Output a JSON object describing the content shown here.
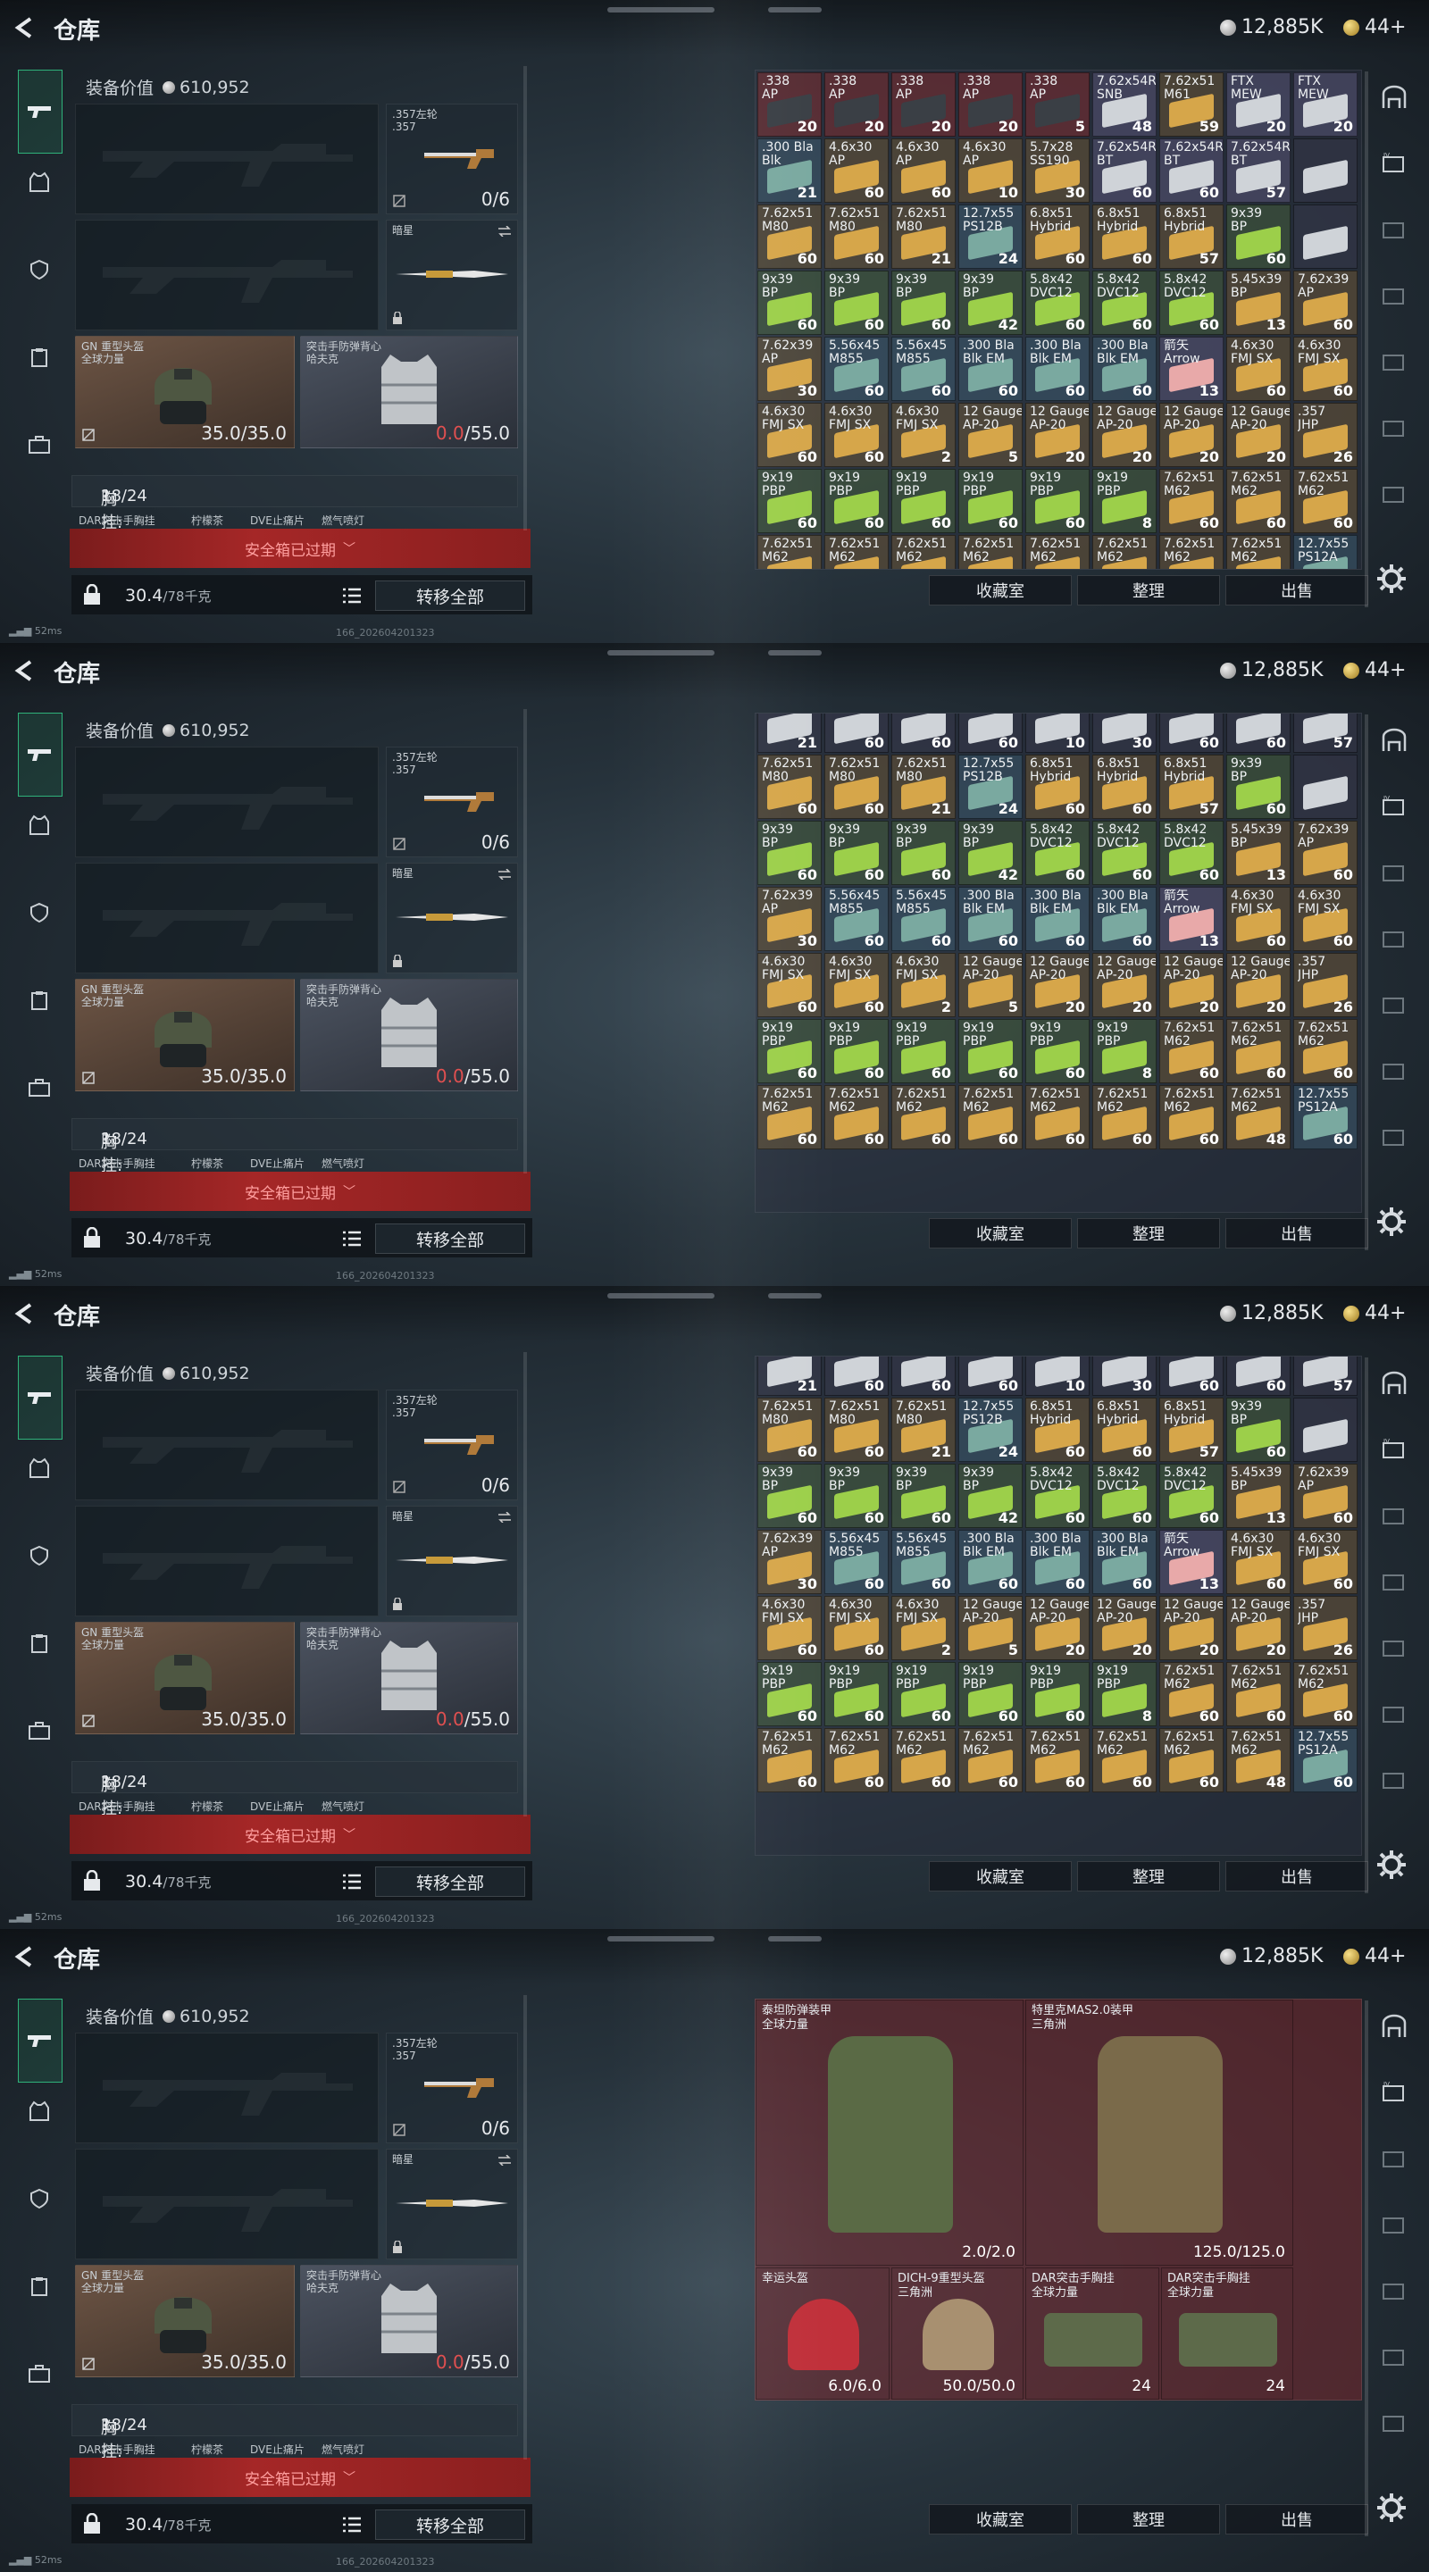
{
  "header": {
    "title": "仓库",
    "silver": "12,885K",
    "gold": "44+"
  },
  "left": {
    "equip_label": "装备价值",
    "equip_value": "610,952",
    "secondary_weapon": {
      "name_line1": ".357左轮",
      "name_line2": ".357",
      "count": "0/6"
    },
    "melee": {
      "name": "暗星"
    },
    "helmet": {
      "name": "GN 重型头盔",
      "brand": "全球力量",
      "durability_cur": "35.0",
      "durability_max": "/35.0"
    },
    "vest": {
      "name": "突击手防弹背心",
      "brand": "哈夫克",
      "durability_cur": "0.0",
      "durability_max": "/55.0"
    },
    "rig": "胸挂:",
    "rig_count": "18/24",
    "rig_help": "?",
    "strip_items": [
      "DAR突击手胸挂",
      "柠檬茶",
      "DVE止痛片",
      "燃气喷灯"
    ],
    "expire": "安全箱已过期",
    "weight": "30.4",
    "weight_max": "/78千克",
    "transfer": "转移全部"
  },
  "buttons": {
    "collect": "收藏室",
    "sort": "整理",
    "sell": "出售"
  },
  "status": {
    "ping": "52ms",
    "build": "166_202604201323"
  },
  "grids": [
    {
      "rows": [
        [
          [
            ".338\nAP",
            "20"
          ],
          [
            ".338\nAP",
            "20"
          ],
          [
            ".338\nAP",
            "20"
          ],
          [
            ".338\nAP",
            "20"
          ],
          [
            ".338\nAP",
            "5"
          ],
          [
            "7.62x54R\nSNB",
            "48"
          ],
          [
            "7.62x51\nM61",
            "59"
          ],
          [
            "FTX\nMEW",
            "20"
          ],
          [
            "FTX\nMEW",
            "20"
          ]
        ],
        [
          [
            ".300 Bla\nBlk",
            "21"
          ],
          [
            "4.6x30\nAP",
            "60"
          ],
          [
            "4.6x30\nAP",
            "60"
          ],
          [
            "4.6x30\nAP",
            "10"
          ],
          [
            "5.7x28\nSS190",
            "30"
          ],
          [
            "7.62x54R\nBT",
            "60"
          ],
          [
            "7.62x54R\nBT",
            "60"
          ],
          [
            "7.62x54R\nBT",
            "57"
          ],
          [
            "",
            ""
          ]
        ],
        [
          [
            "7.62x51\nM80",
            "60"
          ],
          [
            "7.62x51\nM80",
            "60"
          ],
          [
            "7.62x51\nM80",
            "21"
          ],
          [
            "12.7x55\nPS12B",
            "24"
          ],
          [
            "6.8x51\nHybrid",
            "60"
          ],
          [
            "6.8x51\nHybrid",
            "60"
          ],
          [
            "6.8x51\nHybrid",
            "57"
          ],
          [
            "9x39\nBP",
            "60"
          ],
          [
            "",
            ""
          ]
        ],
        [
          [
            "9x39\nBP",
            "60"
          ],
          [
            "9x39\nBP",
            "60"
          ],
          [
            "9x39\nBP",
            "60"
          ],
          [
            "9x39\nBP",
            "42"
          ],
          [
            "5.8x42\nDVC12",
            "60"
          ],
          [
            "5.8x42\nDVC12",
            "60"
          ],
          [
            "5.8x42\nDVC12",
            "60"
          ],
          [
            "5.45x39\nBP",
            "13"
          ],
          [
            "7.62x39\nAP",
            "60"
          ]
        ],
        [
          [
            "7.62x39\nAP",
            "30"
          ],
          [
            "5.56x45\nM855",
            "60"
          ],
          [
            "5.56x45\nM855",
            "60"
          ],
          [
            ".300 Bla\nBlk EM",
            "60"
          ],
          [
            ".300 Bla\nBlk EM",
            "60"
          ],
          [
            ".300 Bla\nBlk EM",
            "60"
          ],
          [
            "箭矢\nArrow",
            "13"
          ],
          [
            "4.6x30\nFMJ SX",
            "60"
          ],
          [
            "4.6x30\nFMJ SX",
            "60"
          ]
        ],
        [
          [
            "4.6x30\nFMJ SX",
            "60"
          ],
          [
            "4.6x30\nFMJ SX",
            "60"
          ],
          [
            "4.6x30\nFMJ SX",
            "2"
          ],
          [
            "12 Gauge\nAP-20",
            "5"
          ],
          [
            "12 Gauge\nAP-20",
            "20"
          ],
          [
            "12 Gauge\nAP-20",
            "20"
          ],
          [
            "12 Gauge\nAP-20",
            "20"
          ],
          [
            "12 Gauge\nAP-20",
            "20"
          ],
          [
            ".357\nJHP",
            "26"
          ]
        ],
        [
          [
            "9x19\nPBP",
            "60"
          ],
          [
            "9x19\nPBP",
            "60"
          ],
          [
            "9x19\nPBP",
            "60"
          ],
          [
            "9x19\nPBP",
            "60"
          ],
          [
            "9x19\nPBP",
            "60"
          ],
          [
            "9x19\nPBP",
            "8"
          ],
          [
            "7.62x51\nM62",
            "60"
          ],
          [
            "7.62x51\nM62",
            "60"
          ],
          [
            "7.62x51\nM62",
            "60"
          ]
        ],
        [
          [
            "7.62x51\nM62",
            "60"
          ],
          [
            "7.62x51\nM62",
            "60"
          ],
          [
            "7.62x51\nM62",
            "60"
          ],
          [
            "7.62x51\nM62",
            "60"
          ],
          [
            "7.62x51\nM62",
            "60"
          ],
          [
            "7.62x51\nM62",
            "60"
          ],
          [
            "7.62x51\nM62",
            "60"
          ],
          [
            "7.62x51\nM62",
            "48"
          ],
          [
            "12.7x55\nPS12A",
            "60"
          ]
        ]
      ]
    },
    {
      "rows": [
        [
          [
            "",
            "21"
          ],
          [
            "",
            "60"
          ],
          [
            "",
            "60"
          ],
          [
            "",
            "60"
          ],
          [
            "",
            "10"
          ],
          [
            "",
            "30"
          ],
          [
            "",
            "60"
          ],
          [
            "",
            "60"
          ],
          [
            "",
            "57"
          ]
        ],
        [
          [
            "7.62x51\nM80",
            "60"
          ],
          [
            "7.62x51\nM80",
            "60"
          ],
          [
            "7.62x51\nM80",
            "21"
          ],
          [
            "12.7x55\nPS12B",
            "24"
          ],
          [
            "6.8x51\nHybrid",
            "60"
          ],
          [
            "6.8x51\nHybrid",
            "60"
          ],
          [
            "6.8x51\nHybrid",
            "57"
          ],
          [
            "9x39\nBP",
            "60"
          ],
          [
            "",
            ""
          ]
        ],
        [
          [
            "9x39\nBP",
            "60"
          ],
          [
            "9x39\nBP",
            "60"
          ],
          [
            "9x39\nBP",
            "60"
          ],
          [
            "9x39\nBP",
            "42"
          ],
          [
            "5.8x42\nDVC12",
            "60"
          ],
          [
            "5.8x42\nDVC12",
            "60"
          ],
          [
            "5.8x42\nDVC12",
            "60"
          ],
          [
            "5.45x39\nBP",
            "13"
          ],
          [
            "7.62x39\nAP",
            "60"
          ]
        ],
        [
          [
            "7.62x39\nAP",
            "30"
          ],
          [
            "5.56x45\nM855",
            "60"
          ],
          [
            "5.56x45\nM855",
            "60"
          ],
          [
            ".300 Bla\nBlk EM",
            "60"
          ],
          [
            ".300 Bla\nBlk EM",
            "60"
          ],
          [
            ".300 Bla\nBlk EM",
            "60"
          ],
          [
            "箭矢\nArrow",
            "13"
          ],
          [
            "4.6x30\nFMJ SX",
            "60"
          ],
          [
            "4.6x30\nFMJ SX",
            "60"
          ]
        ],
        [
          [
            "4.6x30\nFMJ SX",
            "60"
          ],
          [
            "4.6x30\nFMJ SX",
            "60"
          ],
          [
            "4.6x30\nFMJ SX",
            "2"
          ],
          [
            "12 Gauge\nAP-20",
            "5"
          ],
          [
            "12 Gauge\nAP-20",
            "20"
          ],
          [
            "12 Gauge\nAP-20",
            "20"
          ],
          [
            "12 Gauge\nAP-20",
            "20"
          ],
          [
            "12 Gauge\nAP-20",
            "20"
          ],
          [
            ".357\nJHP",
            "26"
          ]
        ],
        [
          [
            "9x19\nPBP",
            "60"
          ],
          [
            "9x19\nPBP",
            "60"
          ],
          [
            "9x19\nPBP",
            "60"
          ],
          [
            "9x19\nPBP",
            "60"
          ],
          [
            "9x19\nPBP",
            "60"
          ],
          [
            "9x19\nPBP",
            "8"
          ],
          [
            "7.62x51\nM62",
            "60"
          ],
          [
            "7.62x51\nM62",
            "60"
          ],
          [
            "7.62x51\nM62",
            "60"
          ]
        ],
        [
          [
            "7.62x51\nM62",
            "60"
          ],
          [
            "7.62x51\nM62",
            "60"
          ],
          [
            "7.62x51\nM62",
            "60"
          ],
          [
            "7.62x51\nM62",
            "60"
          ],
          [
            "7.62x51\nM62",
            "60"
          ],
          [
            "7.62x51\nM62",
            "60"
          ],
          [
            "7.62x51\nM62",
            "60"
          ],
          [
            "7.62x51\nM62",
            "48"
          ],
          [
            "12.7x55\nPS12A",
            "60"
          ]
        ]
      ]
    },
    {
      "rows": [
        [
          [
            "",
            "21"
          ],
          [
            "",
            "60"
          ],
          [
            "",
            "60"
          ],
          [
            "",
            "60"
          ],
          [
            "",
            "10"
          ],
          [
            "",
            "30"
          ],
          [
            "",
            "60"
          ],
          [
            "",
            "60"
          ],
          [
            "",
            "57"
          ]
        ],
        [
          [
            "7.62x51\nM80",
            "60"
          ],
          [
            "7.62x51\nM80",
            "60"
          ],
          [
            "7.62x51\nM80",
            "21"
          ],
          [
            "12.7x55\nPS12B",
            "24"
          ],
          [
            "6.8x51\nHybrid",
            "60"
          ],
          [
            "6.8x51\nHybrid",
            "60"
          ],
          [
            "6.8x51\nHybrid",
            "57"
          ],
          [
            "9x39\nBP",
            "60"
          ],
          [
            "",
            ""
          ]
        ],
        [
          [
            "9x39\nBP",
            "60"
          ],
          [
            "9x39\nBP",
            "60"
          ],
          [
            "9x39\nBP",
            "60"
          ],
          [
            "9x39\nBP",
            "42"
          ],
          [
            "5.8x42\nDVC12",
            "60"
          ],
          [
            "5.8x42\nDVC12",
            "60"
          ],
          [
            "5.8x42\nDVC12",
            "60"
          ],
          [
            "5.45x39\nBP",
            "13"
          ],
          [
            "7.62x39\nAP",
            "60"
          ]
        ],
        [
          [
            "7.62x39\nAP",
            "30"
          ],
          [
            "5.56x45\nM855",
            "60"
          ],
          [
            "5.56x45\nM855",
            "60"
          ],
          [
            ".300 Bla\nBlk EM",
            "60"
          ],
          [
            ".300 Bla\nBlk EM",
            "60"
          ],
          [
            ".300 Bla\nBlk EM",
            "60"
          ],
          [
            "箭矢\nArrow",
            "13"
          ],
          [
            "4.6x30\nFMJ SX",
            "60"
          ],
          [
            "4.6x30\nFMJ SX",
            "60"
          ]
        ],
        [
          [
            "4.6x30\nFMJ SX",
            "60"
          ],
          [
            "4.6x30\nFMJ SX",
            "60"
          ],
          [
            "4.6x30\nFMJ SX",
            "2"
          ],
          [
            "12 Gauge\nAP-20",
            "5"
          ],
          [
            "12 Gauge\nAP-20",
            "20"
          ],
          [
            "12 Gauge\nAP-20",
            "20"
          ],
          [
            "12 Gauge\nAP-20",
            "20"
          ],
          [
            "12 Gauge\nAP-20",
            "20"
          ],
          [
            ".357\nJHP",
            "26"
          ]
        ],
        [
          [
            "9x19\nPBP",
            "60"
          ],
          [
            "9x19\nPBP",
            "60"
          ],
          [
            "9x19\nPBP",
            "60"
          ],
          [
            "9x19\nPBP",
            "60"
          ],
          [
            "9x19\nPBP",
            "60"
          ],
          [
            "9x19\nPBP",
            "8"
          ],
          [
            "7.62x51\nM62",
            "60"
          ],
          [
            "7.62x51\nM62",
            "60"
          ],
          [
            "7.62x51\nM62",
            "60"
          ]
        ],
        [
          [
            "7.62x51\nM62",
            "60"
          ],
          [
            "7.62x51\nM62",
            "60"
          ],
          [
            "7.62x51\nM62",
            "60"
          ],
          [
            "7.62x51\nM62",
            "60"
          ],
          [
            "7.62x51\nM62",
            "60"
          ],
          [
            "7.62x51\nM62",
            "60"
          ],
          [
            "7.62x51\nM62",
            "60"
          ],
          [
            "7.62x51\nM62",
            "48"
          ],
          [
            "12.7x55\nPS12A",
            "60"
          ]
        ]
      ]
    }
  ],
  "armor": {
    "items": [
      {
        "name": "泰坦防弹装甲",
        "brand": "全球力量",
        "dur": "2.0/2.0"
      },
      {
        "name": "特里克MAS2.0装甲",
        "brand": "三角洲",
        "dur": "125.0/125.0"
      },
      {
        "name": "幸运头盔",
        "brand": "",
        "dur": "6.0/6.0"
      },
      {
        "name": "DICH-9重型头盔",
        "brand": "三角洲",
        "dur": "50.0/50.0"
      },
      {
        "name": "DAR突击手胸挂",
        "brand": "全球力量",
        "dur": "24"
      },
      {
        "name": "DAR突击手胸挂",
        "brand": "全球力量",
        "dur": "24"
      }
    ]
  }
}
